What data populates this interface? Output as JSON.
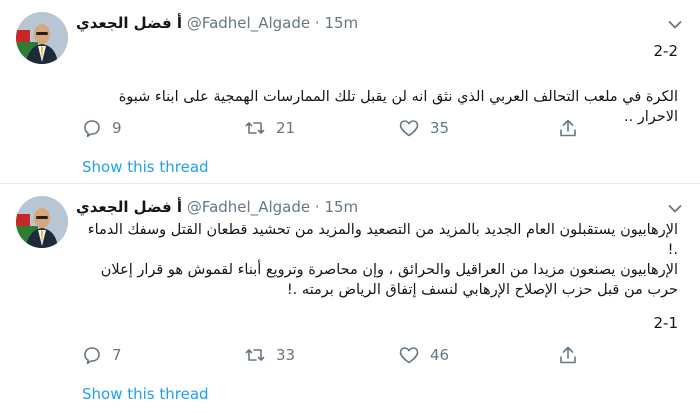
{
  "tweets": [
    {
      "name": "أ فضل الجعدي",
      "handle": "@Fadhel_Algade",
      "separator": "·",
      "time": "15m",
      "thread_number": "2-2",
      "text_lines": [
        "الكرة في ملعب التحالف العربي الذي نثق انه لن يقبل تلك الممارسات الهمجية على ابناء شبوة الاحرار .."
      ],
      "replies": "9",
      "retweets": "21",
      "likes": "35",
      "show_thread": "Show this thread"
    },
    {
      "name": "أ فضل الجعدي",
      "handle": "@Fadhel_Algade",
      "separator": "·",
      "time": "15m",
      "thread_number": "2-1",
      "text_lines": [
        "الإرهابيون يستقبلون العام الجديد بالمزيد من التصعيد والمزيد من تحشيد قطعان القتل وسفك الدماء .!",
        "الإرهابيون يصنعون مزيدا من العراقيل والحرائق ، وإن محاصرة وترويع أبناء لقموش هو قرار إعلان",
        "حرب من قبل حزب الإصلاح الإرهابي لنسف إتفاق الرياض برمته .!"
      ],
      "replies": "7",
      "retweets": "33",
      "likes": "46",
      "show_thread": "Show this thread"
    }
  ],
  "icons": {
    "reply": "reply-icon",
    "retweet": "retweet-icon",
    "like": "heart-icon",
    "share": "share-icon",
    "caret": "chevron-down-icon"
  },
  "colors": {
    "link": "#1da1f2",
    "meta": "#657786",
    "text": "#14171a",
    "divider": "#e6ecf0"
  }
}
